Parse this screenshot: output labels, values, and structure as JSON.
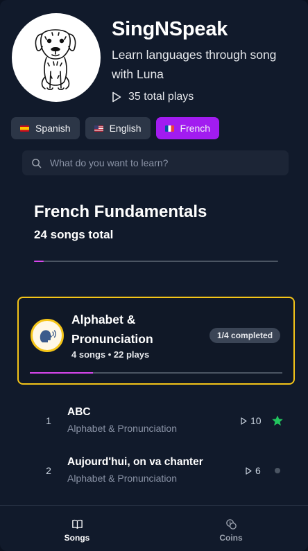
{
  "header": {
    "app_name": "SingNSpeak",
    "subtitle": "Learn languages through song with Luna",
    "total_plays": "35 total plays",
    "avatar_icon": "dog-mascot-icon"
  },
  "languages": [
    {
      "label": "Spanish",
      "flag": "flag-es",
      "active": false
    },
    {
      "label": "English",
      "flag": "flag-us",
      "active": false
    },
    {
      "label": "French",
      "flag": "flag-fr",
      "active": true
    }
  ],
  "search": {
    "placeholder": "What do you want to learn?",
    "value": ""
  },
  "course": {
    "title": "French Fundamentals",
    "count": "24 songs total",
    "progress": 0.04
  },
  "unit": {
    "title": "Alphabet & Pronunciation",
    "meta": "4 songs • 22 plays",
    "badge": "1/4 completed",
    "progress": 0.25,
    "icon": "speaking-head-icon"
  },
  "songs": [
    {
      "num": "1",
      "title": "ABC",
      "unit": "Alphabet & Pronunciation",
      "plays": "10",
      "status": "completed"
    },
    {
      "num": "2",
      "title": "Aujourd'hui, on va chanter",
      "unit": "Alphabet & Pronunciation",
      "plays": "6",
      "status": "not-started"
    }
  ],
  "nav": [
    {
      "label": "Songs",
      "icon": "book-icon",
      "active": true
    },
    {
      "label": "Coins",
      "icon": "coins-icon",
      "active": false
    }
  ],
  "colors": {
    "accent": "#a21cf0",
    "progress": "#d946ef",
    "highlight": "#f5c518",
    "success": "#22c55e",
    "background": "#111a2b"
  }
}
